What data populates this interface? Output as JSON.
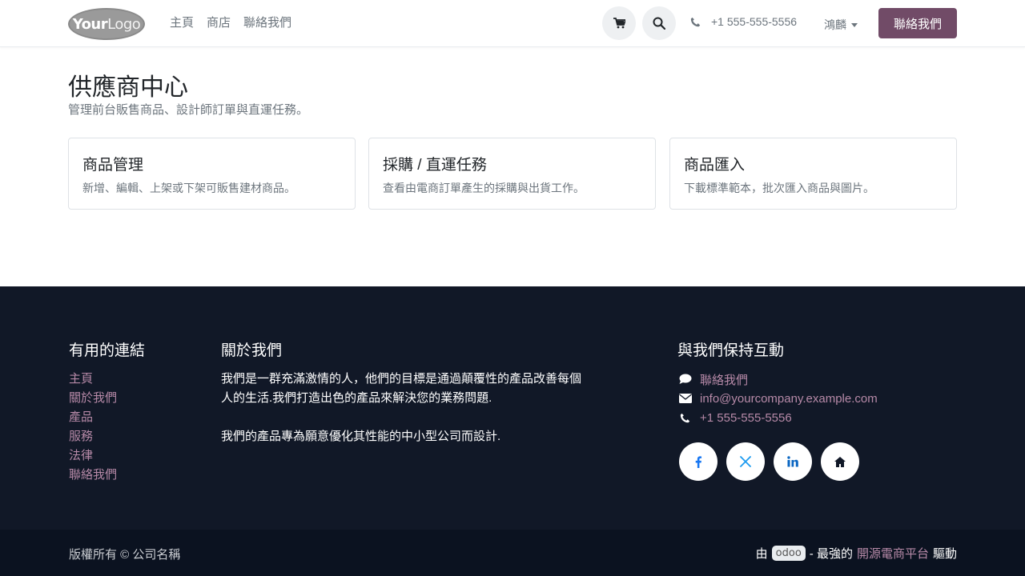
{
  "header": {
    "logo": {
      "your": "Your",
      "logo": "Logo"
    },
    "nav": [
      "主頁",
      "商店",
      "聯絡我們"
    ],
    "phone": "+1 555-555-5556",
    "language": "鴻麟",
    "contact_button": "聯絡我們"
  },
  "main": {
    "title": "供應商中心",
    "subtitle": "管理前台販售商品、設計師訂單與直運任務。",
    "cards": [
      {
        "title": "商品管理",
        "text": "新增、編輯、上架或下架可販售建材商品。"
      },
      {
        "title": "採購 / 直運任務",
        "text": "查看由電商訂單產生的採購與出貨工作。"
      },
      {
        "title": "商品匯入",
        "text": "下載標準範本，批次匯入商品與圖片。"
      }
    ]
  },
  "footer": {
    "links_heading": "有用的連結",
    "links": [
      "主頁",
      "關於我們",
      "產品",
      "服務",
      "法律",
      "聯絡我們"
    ],
    "about_heading": "關於我們",
    "about_p1": "我們是一群充滿激情的人，他們的目標是通過顛覆性的產品改善每個人的生活.我們打造出色的產品來解決您的業務問題.",
    "about_p2": "我們的產品專為願意優化其性能的中小型公司而設計.",
    "connect_heading": "與我們保持互動",
    "contact": {
      "chat": "聯絡我們",
      "email": "info@yourcompany.example.com",
      "phone": "+1 555-555-5556"
    },
    "social_icons": [
      "facebook-icon",
      "x-icon",
      "linkedin-icon",
      "home-icon"
    ]
  },
  "copyright": {
    "left": "版權所有 © 公司名稱",
    "by": "由",
    "odoo": "odoo",
    "dash": "- 最強的",
    "link": "開源電商平台",
    "powered": "驅動"
  },
  "colors": {
    "accent": "#714b67",
    "footer_bg": "#111827",
    "link": "#b78aa8"
  }
}
